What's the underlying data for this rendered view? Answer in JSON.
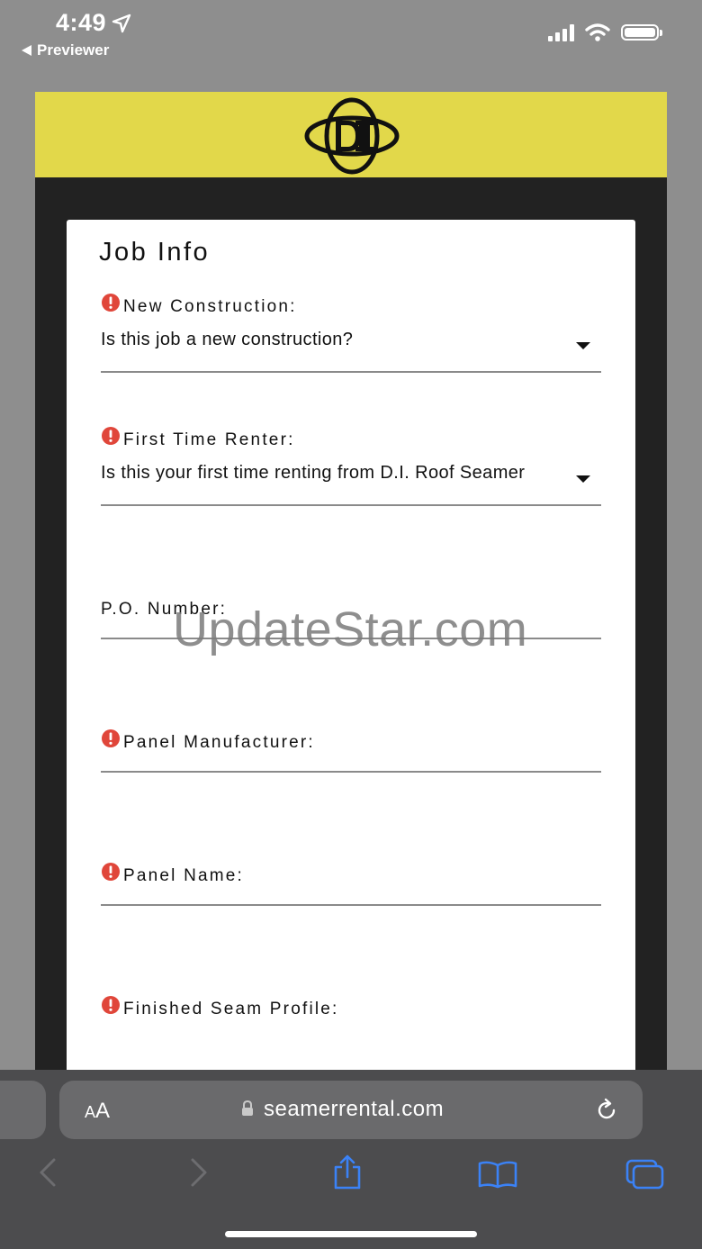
{
  "status_bar": {
    "time": "4:49",
    "back_label": "Previewer"
  },
  "form": {
    "title": "Job Info",
    "fields": [
      {
        "label": "New Construction:",
        "required": true,
        "value": "Is this job a new construction?",
        "type": "select"
      },
      {
        "label": "First Time Renter:",
        "required": true,
        "value": "Is this your first time renting from D.I. Roof Seamer",
        "type": "select"
      },
      {
        "label": "P.O. Number:",
        "required": false,
        "value": "",
        "type": "text"
      },
      {
        "label": "Panel Manufacturer:",
        "required": true,
        "value": "",
        "type": "text"
      },
      {
        "label": "Panel Name:",
        "required": true,
        "value": "",
        "type": "text"
      },
      {
        "label": "Finished Seam Profile:",
        "required": true,
        "value": "",
        "type": "text"
      }
    ]
  },
  "watermark": "UpdateStar.com",
  "browser": {
    "text_size_label_small": "A",
    "text_size_label_large": "A",
    "url": "seamerrental.com"
  },
  "colors": {
    "header_yellow": "#e2d84a",
    "page_dark": "#222222",
    "required_red": "#e0463a",
    "toolbar_bg": "#4c4c4e",
    "toolbar_accent": "#3b82f6"
  }
}
